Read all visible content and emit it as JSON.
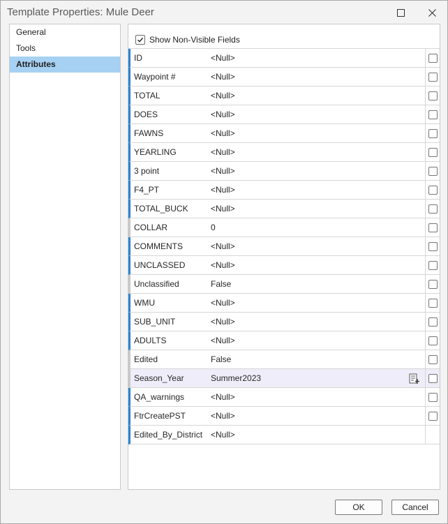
{
  "window": {
    "title": "Template Properties: Mule Deer"
  },
  "nav": {
    "items": [
      {
        "label": "General",
        "selected": false
      },
      {
        "label": "Tools",
        "selected": false
      },
      {
        "label": "Attributes",
        "selected": true
      }
    ]
  },
  "attributes": {
    "show_non_visible_label": "Show Non-Visible Fields",
    "show_non_visible_checked": true,
    "rows": [
      {
        "name": "ID",
        "value": "<Null>"
      },
      {
        "name": "Waypoint #",
        "value": "<Null>"
      },
      {
        "name": "TOTAL",
        "value": "<Null>"
      },
      {
        "name": "DOES",
        "value": "<Null>"
      },
      {
        "name": "FAWNS",
        "value": "<Null>"
      },
      {
        "name": "YEARLING",
        "value": "<Null>"
      },
      {
        "name": "3 point",
        "value": "<Null>"
      },
      {
        "name": "F4_PT",
        "value": "<Null>"
      },
      {
        "name": "TOTAL_BUCK",
        "value": "<Null>"
      },
      {
        "name": "COLLAR",
        "value": "0"
      },
      {
        "name": "COMMENTS",
        "value": "<Null>"
      },
      {
        "name": "UNCLASSED",
        "value": "<Null>"
      },
      {
        "name": "Unclassified",
        "value": "False"
      },
      {
        "name": "WMU",
        "value": "<Null>"
      },
      {
        "name": "SUB_UNIT",
        "value": "<Null>"
      },
      {
        "name": "ADULTS",
        "value": "<Null>"
      },
      {
        "name": "Edited",
        "value": "False"
      },
      {
        "name": "Season_Year",
        "value": "Summer2023"
      },
      {
        "name": "QA_warnings",
        "value": "<Null>"
      },
      {
        "name": "FtrCreatePST",
        "value": "<Null>"
      },
      {
        "name": "Edited_By_District",
        "value": "<Null>"
      }
    ]
  },
  "footer": {
    "ok_label": "OK",
    "cancel_label": "Cancel"
  },
  "colors": {
    "accent": "#2c84cf",
    "selection": "#a6d1f3",
    "row_highlight": "#f0edfa"
  }
}
